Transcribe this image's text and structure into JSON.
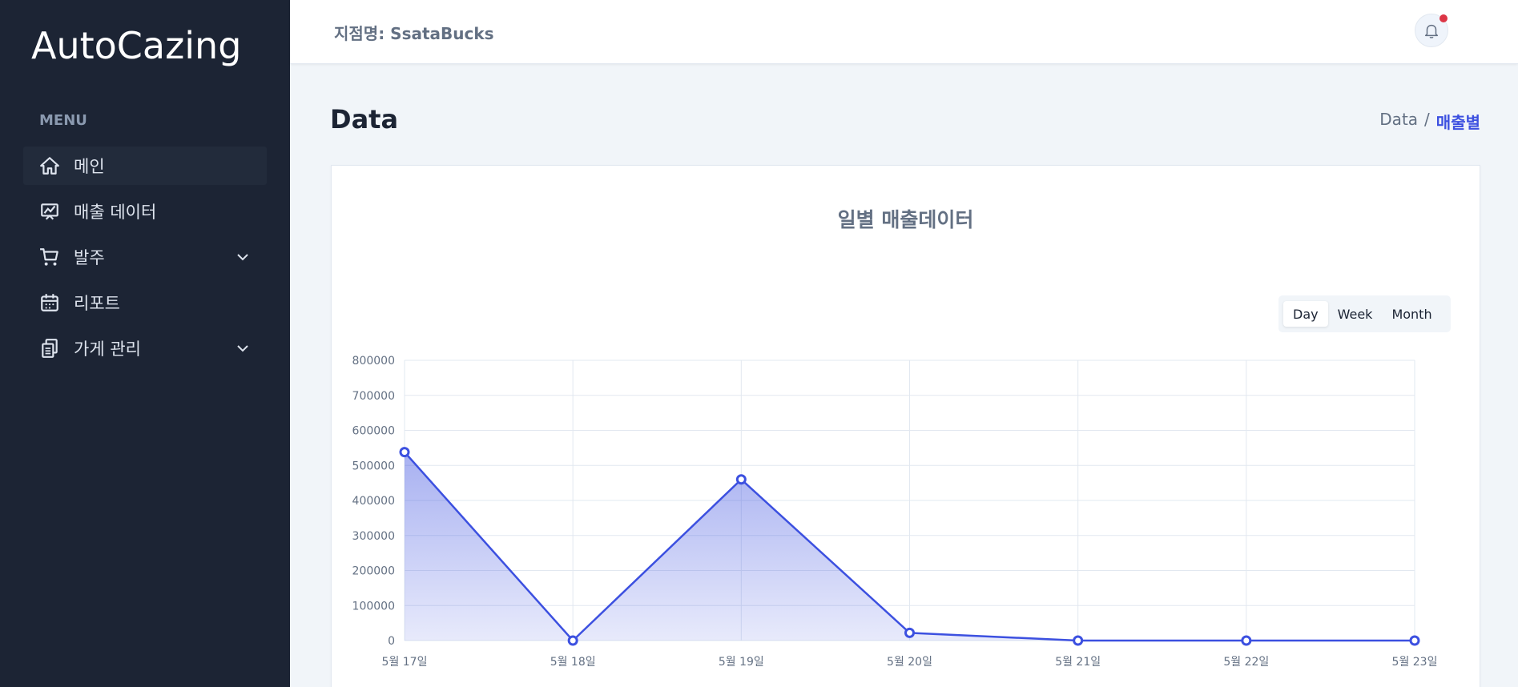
{
  "sidebar": {
    "logo": "AutoCazing",
    "menu_heading": "MENU",
    "items": [
      {
        "label": "메인",
        "icon": "home-icon"
      },
      {
        "label": "매출 데이터",
        "icon": "chart-board-icon"
      },
      {
        "label": "발주",
        "icon": "cart-icon",
        "expandable": true
      },
      {
        "label": "리포트",
        "icon": "calendar-icon"
      },
      {
        "label": "가게 관리",
        "icon": "documents-icon",
        "expandable": true
      }
    ]
  },
  "header": {
    "store_label": "지점명: SsataBucks",
    "notification_icon": "bell-icon"
  },
  "page": {
    "title": "Data",
    "breadcrumb_parent": "Data",
    "breadcrumb_separator": "/",
    "breadcrumb_current": "매출별"
  },
  "chart_card": {
    "title": "일별 매출데이터",
    "toggle": [
      "Day",
      "Week",
      "Month"
    ],
    "toggle_selected": "Day"
  },
  "chart_data": {
    "type": "area",
    "title": "일별 매출데이터",
    "xlabel": "",
    "ylabel": "",
    "categories": [
      "5월 17일",
      "5월 18일",
      "5월 19일",
      "5월 20일",
      "5월 21일",
      "5월 22일",
      "5월 23일"
    ],
    "values": [
      538000,
      0,
      460000,
      22000,
      0,
      0,
      0
    ],
    "yticks": [
      0,
      100000,
      200000,
      300000,
      400000,
      500000,
      600000,
      700000,
      800000
    ],
    "ylim": [
      0,
      800000
    ],
    "grid": true,
    "color": "#3c50e0"
  },
  "colors": {
    "sidebar_bg": "#1c2434",
    "accent": "#3c50e0",
    "notification_dot": "#dc3545"
  }
}
